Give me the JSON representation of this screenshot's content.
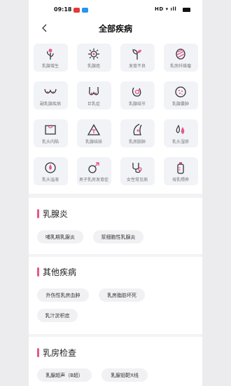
{
  "status": {
    "time": "09:18",
    "right": "HD ▾ ıll"
  },
  "nav": {
    "title": "全部疾病"
  },
  "grid": [
    {
      "label": "乳腺增生",
      "icon": "flower-stem-icon"
    },
    {
      "label": "乳腺癌",
      "icon": "virus-icon"
    },
    {
      "label": "发育不良",
      "icon": "sprout-icon"
    },
    {
      "label": "乳房纤维瘤",
      "icon": "striped-oval-icon"
    },
    {
      "label": "副乳腺疾病",
      "icon": "extra-breast-icon"
    },
    {
      "label": "巨乳症",
      "icon": "large-breast-icon"
    },
    {
      "label": "乳腺结节",
      "icon": "nodule-icon"
    },
    {
      "label": "乳腺囊肿",
      "icon": "cyst-icon"
    },
    {
      "label": "乳头内陷",
      "icon": "shirt-icon"
    },
    {
      "label": "乳腺结核",
      "icon": "warning-triangle-icon"
    },
    {
      "label": "乳房脓肿",
      "icon": "abscess-icon"
    },
    {
      "label": "乳头湿疹",
      "icon": "droplets-icon"
    },
    {
      "label": "乳头溢液",
      "icon": "drop-circle-icon"
    },
    {
      "label": "男子乳房发育症",
      "icon": "male-symbol-icon"
    },
    {
      "label": "女性常见病",
      "icon": "stethoscope-icon"
    },
    {
      "label": "母乳喂养",
      "icon": "baby-bottle-icon"
    }
  ],
  "sections": [
    {
      "title": "乳腺炎",
      "chips": [
        "哺乳期乳腺炎",
        "浆细胞性乳腺炎"
      ]
    },
    {
      "title": "其他疾病",
      "chips": [
        "外伤性乳房血肿",
        "乳房脂肪坏死",
        "乳汁淤积症"
      ]
    },
    {
      "title": "乳房检查",
      "chips": [
        "乳腺超声（B超）",
        "乳腺钼靶X线"
      ]
    }
  ],
  "colors": {
    "accent": "#e8558f",
    "icon_dark": "#333333",
    "icon_pink": "#e8558f"
  }
}
